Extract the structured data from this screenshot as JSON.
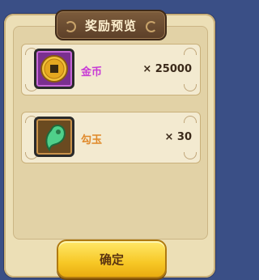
{
  "dialog": {
    "title": "奖励预览",
    "confirm_label": "确定"
  },
  "rewards": [
    {
      "name": "金币",
      "count": "× 25000",
      "icon": "gold-coin-icon"
    },
    {
      "name": "勾玉",
      "count": "× 30",
      "icon": "jade-magatama-icon"
    }
  ],
  "colors": {
    "background": "#3a4f86",
    "panel": "#ecdfb6",
    "button": "#f7c826",
    "gold_name": "#c83bd6",
    "jade_name": "#e0892a"
  }
}
